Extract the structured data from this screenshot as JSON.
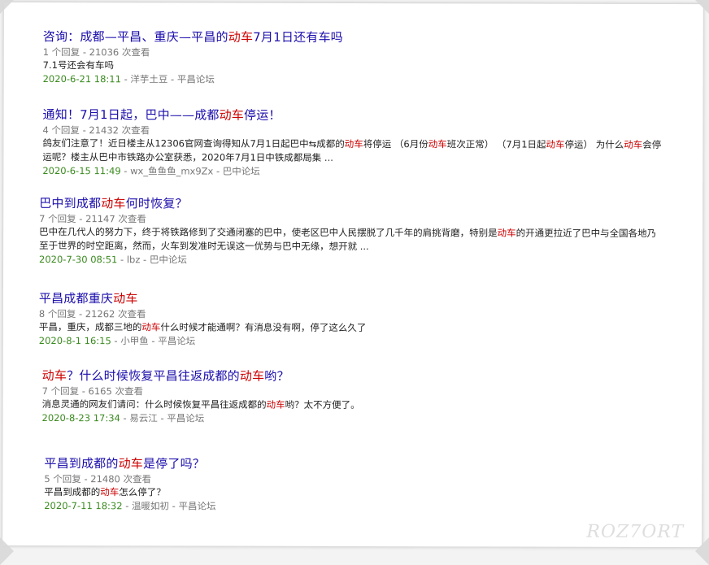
{
  "results": [
    {
      "title": [
        {
          "t": "咨询：成都—平昌、重庆—平昌的",
          "hl": false
        },
        {
          "t": "动车",
          "hl": true
        },
        {
          "t": "7月1日还有车吗",
          "hl": false
        }
      ],
      "stats": "1 个回复 - 21036 次查看",
      "snippet": [
        {
          "t": "7.1号还会有车吗",
          "hl": false
        }
      ],
      "date": "2020-6-21 18:11",
      "author": "洋芋土豆",
      "forum": "平昌论坛"
    },
    {
      "title": [
        {
          "t": "通知！7月1日起，巴中——成都",
          "hl": false
        },
        {
          "t": "动车",
          "hl": true
        },
        {
          "t": "停运！",
          "hl": false
        }
      ],
      "stats": "4 个回复 - 21432 次查看",
      "snippet": [
        {
          "t": "鸽友们注意了！近日楼主从12306官网查询得知从7月1日起巴中⇆成都的",
          "hl": false
        },
        {
          "t": "动车",
          "hl": true
        },
        {
          "t": "将停运 （6月份",
          "hl": false
        },
        {
          "t": "动车",
          "hl": true
        },
        {
          "t": "班次正常） （7月1日起",
          "hl": false
        },
        {
          "t": "动车",
          "hl": true
        },
        {
          "t": "停运） 为什么",
          "hl": false
        },
        {
          "t": "动车",
          "hl": true
        },
        {
          "t": "会停运呢？楼主从巴中市铁路办公室获悉，2020年7月1日中铁成都局集 ...",
          "hl": false
        }
      ],
      "date": "2020-6-15 11:49",
      "author": "wx_鱼鱼鱼_mx9Zx",
      "forum": "巴中论坛"
    },
    {
      "title": [
        {
          "t": "巴中到成都",
          "hl": false
        },
        {
          "t": "动车",
          "hl": true
        },
        {
          "t": "何时恢复？",
          "hl": false
        }
      ],
      "stats": "7 个回复 - 21147 次查看",
      "snippet": [
        {
          "t": "巴中在几代人的努力下，终于将铁路修到了交通闭塞的巴中，使老区巴中人民摆脱了几千年的肩挑背磨，特别是",
          "hl": false
        },
        {
          "t": "动车",
          "hl": true
        },
        {
          "t": "的开通更拉近了巴中与全国各地乃至于世界的时空距离，然而，火车到发准时无误这一优势与巴中无缘，想开就 ...",
          "hl": false
        }
      ],
      "date": "2020-7-30 08:51",
      "author": "lbz",
      "forum": "巴中论坛"
    },
    {
      "title": [
        {
          "t": "平昌成都重庆",
          "hl": false
        },
        {
          "t": "动车",
          "hl": true
        }
      ],
      "stats": "8 个回复 - 21262 次查看",
      "snippet": [
        {
          "t": "平昌，重庆，成都三地的",
          "hl": false
        },
        {
          "t": "动车",
          "hl": true
        },
        {
          "t": "什么时候才能通啊？有消息没有啊，停了这么久了",
          "hl": false
        }
      ],
      "date": "2020-8-1 16:15",
      "author": "小甲鱼",
      "forum": "平昌论坛"
    },
    {
      "title": [
        {
          "t": "动车",
          "hl": true
        },
        {
          "t": "？什么时候恢复平昌往返成都的",
          "hl": false
        },
        {
          "t": "动车",
          "hl": true
        },
        {
          "t": "哟？",
          "hl": false
        }
      ],
      "stats": "7 个回复 - 6165 次查看",
      "snippet": [
        {
          "t": "消息灵通的网友们请问：什么时候恢复平昌往返成都的",
          "hl": false
        },
        {
          "t": "动车",
          "hl": true
        },
        {
          "t": "哟？太不方便了。",
          "hl": false
        }
      ],
      "date": "2020-8-23 17:34",
      "author": "易云江",
      "forum": "平昌论坛"
    },
    {
      "title": [
        {
          "t": "平昌到成都的",
          "hl": false
        },
        {
          "t": "动车",
          "hl": true
        },
        {
          "t": "是停了吗？",
          "hl": false
        }
      ],
      "stats": "5 个回复 - 21480 次查看",
      "snippet": [
        {
          "t": "平昌到成都的",
          "hl": false
        },
        {
          "t": "动车",
          "hl": true
        },
        {
          "t": "怎么停了？",
          "hl": false
        }
      ],
      "date": "2020-7-11 18:32",
      "author": "温暖如初",
      "forum": "平昌论坛"
    }
  ],
  "separator": " - ",
  "watermark": "ROZ7ORT"
}
